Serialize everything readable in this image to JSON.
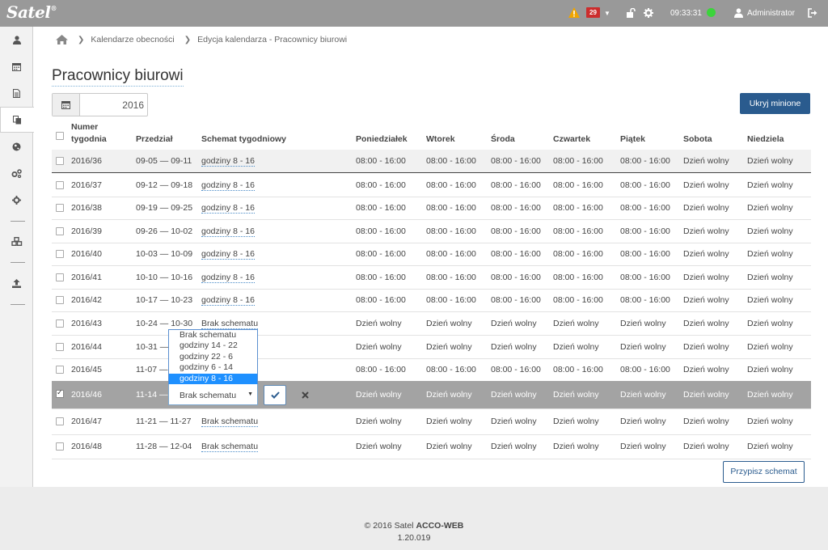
{
  "topbar": {
    "brand": "Satel",
    "brand_mark": "®",
    "alert_count": "29",
    "time": "09:33:31",
    "status_color": "#3bd43b",
    "user": "Administrator"
  },
  "breadcrumb": {
    "items": [
      "Kalendarze obecności",
      "Edycja kalendarza - Pracownicy biurowi"
    ]
  },
  "page": {
    "title": "Pracownicy biurowi",
    "year": "2016",
    "hide_past_label": "Ukryj minione",
    "assign_label": "Przypisz schemat"
  },
  "table": {
    "headers": {
      "week_line1": "Numer",
      "week_line2": "tygodnia",
      "range": "Przedział",
      "schema": "Schemat tygodniowy",
      "mon": "Poniedziałek",
      "tue": "Wtorek",
      "wed": "Środa",
      "thu": "Czwartek",
      "fri": "Piątek",
      "sat": "Sobota",
      "sun": "Niedziela"
    },
    "rows": [
      {
        "week": "2016/36",
        "range": "09-05 — 09-11",
        "schema": "godziny 8 - 16",
        "mon": "08:00 - 16:00",
        "tue": "08:00 - 16:00",
        "wed": "08:00 - 16:00",
        "thu": "08:00 - 16:00",
        "fri": "08:00 - 16:00",
        "sat": "Dzień wolny",
        "sun": "Dzień wolny"
      },
      {
        "week": "2016/37",
        "range": "09-12 — 09-18",
        "schema": "godziny 8 - 16",
        "mon": "08:00 - 16:00",
        "tue": "08:00 - 16:00",
        "wed": "08:00 - 16:00",
        "thu": "08:00 - 16:00",
        "fri": "08:00 - 16:00",
        "sat": "Dzień wolny",
        "sun": "Dzień wolny"
      },
      {
        "week": "2016/38",
        "range": "09-19 — 09-25",
        "schema": "godziny 8 - 16",
        "mon": "08:00 - 16:00",
        "tue": "08:00 - 16:00",
        "wed": "08:00 - 16:00",
        "thu": "08:00 - 16:00",
        "fri": "08:00 - 16:00",
        "sat": "Dzień wolny",
        "sun": "Dzień wolny"
      },
      {
        "week": "2016/39",
        "range": "09-26 — 10-02",
        "schema": "godziny 8 - 16",
        "mon": "08:00 - 16:00",
        "tue": "08:00 - 16:00",
        "wed": "08:00 - 16:00",
        "thu": "08:00 - 16:00",
        "fri": "08:00 - 16:00",
        "sat": "Dzień wolny",
        "sun": "Dzień wolny"
      },
      {
        "week": "2016/40",
        "range": "10-03 — 10-09",
        "schema": "godziny 8 - 16",
        "mon": "08:00 - 16:00",
        "tue": "08:00 - 16:00",
        "wed": "08:00 - 16:00",
        "thu": "08:00 - 16:00",
        "fri": "08:00 - 16:00",
        "sat": "Dzień wolny",
        "sun": "Dzień wolny"
      },
      {
        "week": "2016/41",
        "range": "10-10 — 10-16",
        "schema": "godziny 8 - 16",
        "mon": "08:00 - 16:00",
        "tue": "08:00 - 16:00",
        "wed": "08:00 - 16:00",
        "thu": "08:00 - 16:00",
        "fri": "08:00 - 16:00",
        "sat": "Dzień wolny",
        "sun": "Dzień wolny"
      },
      {
        "week": "2016/42",
        "range": "10-17 — 10-23",
        "schema": "godziny 8 - 16",
        "mon": "08:00 - 16:00",
        "tue": "08:00 - 16:00",
        "wed": "08:00 - 16:00",
        "thu": "08:00 - 16:00",
        "fri": "08:00 - 16:00",
        "sat": "Dzień wolny",
        "sun": "Dzień wolny"
      },
      {
        "week": "2016/43",
        "range": "10-24 — 10-30",
        "schema": "Brak schematu",
        "mon": "Dzień wolny",
        "tue": "Dzień wolny",
        "wed": "Dzień wolny",
        "thu": "Dzień wolny",
        "fri": "Dzień wolny",
        "sat": "Dzień wolny",
        "sun": "Dzień wolny"
      },
      {
        "week": "2016/44",
        "range": "10-31 — 11-06",
        "schema": "",
        "mon": "Dzień wolny",
        "tue": "Dzień wolny",
        "wed": "Dzień wolny",
        "thu": "Dzień wolny",
        "fri": "Dzień wolny",
        "sat": "Dzień wolny",
        "sun": "Dzień wolny"
      },
      {
        "week": "2016/45",
        "range": "11-07 — 11-13",
        "schema": "",
        "mon": "08:00 - 16:00",
        "tue": "08:00 - 16:00",
        "wed": "08:00 - 16:00",
        "thu": "08:00 - 16:00",
        "fri": "08:00 - 16:00",
        "sat": "Dzień wolny",
        "sun": "Dzień wolny"
      },
      {
        "week": "2016/46",
        "range": "11-14 — 11-20",
        "schema": "",
        "mon": "Dzień wolny",
        "tue": "Dzień wolny",
        "wed": "Dzień wolny",
        "thu": "Dzień wolny",
        "fri": "Dzień wolny",
        "sat": "Dzień wolny",
        "sun": "Dzień wolny"
      },
      {
        "week": "2016/47",
        "range": "11-21 — 11-27",
        "schema": "Brak schematu",
        "mon": "Dzień wolny",
        "tue": "Dzień wolny",
        "wed": "Dzień wolny",
        "thu": "Dzień wolny",
        "fri": "Dzień wolny",
        "sat": "Dzień wolny",
        "sun": "Dzień wolny"
      },
      {
        "week": "2016/48",
        "range": "11-28 — 12-04",
        "schema": "Brak schematu",
        "mon": "Dzień wolny",
        "tue": "Dzień wolny",
        "wed": "Dzień wolny",
        "thu": "Dzień wolny",
        "fri": "Dzień wolny",
        "sat": "Dzień wolny",
        "sun": "Dzień wolny"
      }
    ]
  },
  "schema_dropdown": {
    "selected": "Brak schematu",
    "options": [
      "Brak schematu",
      "godziny 14 - 22",
      "godziny 22 - 6",
      "godziny 6 - 14",
      "godziny 8 - 16"
    ],
    "highlighted_option": "godziny 8 - 16"
  },
  "footer": {
    "copyright": "© 2016 Satel",
    "product": "ACCO-WEB",
    "version": "1.20.019"
  }
}
